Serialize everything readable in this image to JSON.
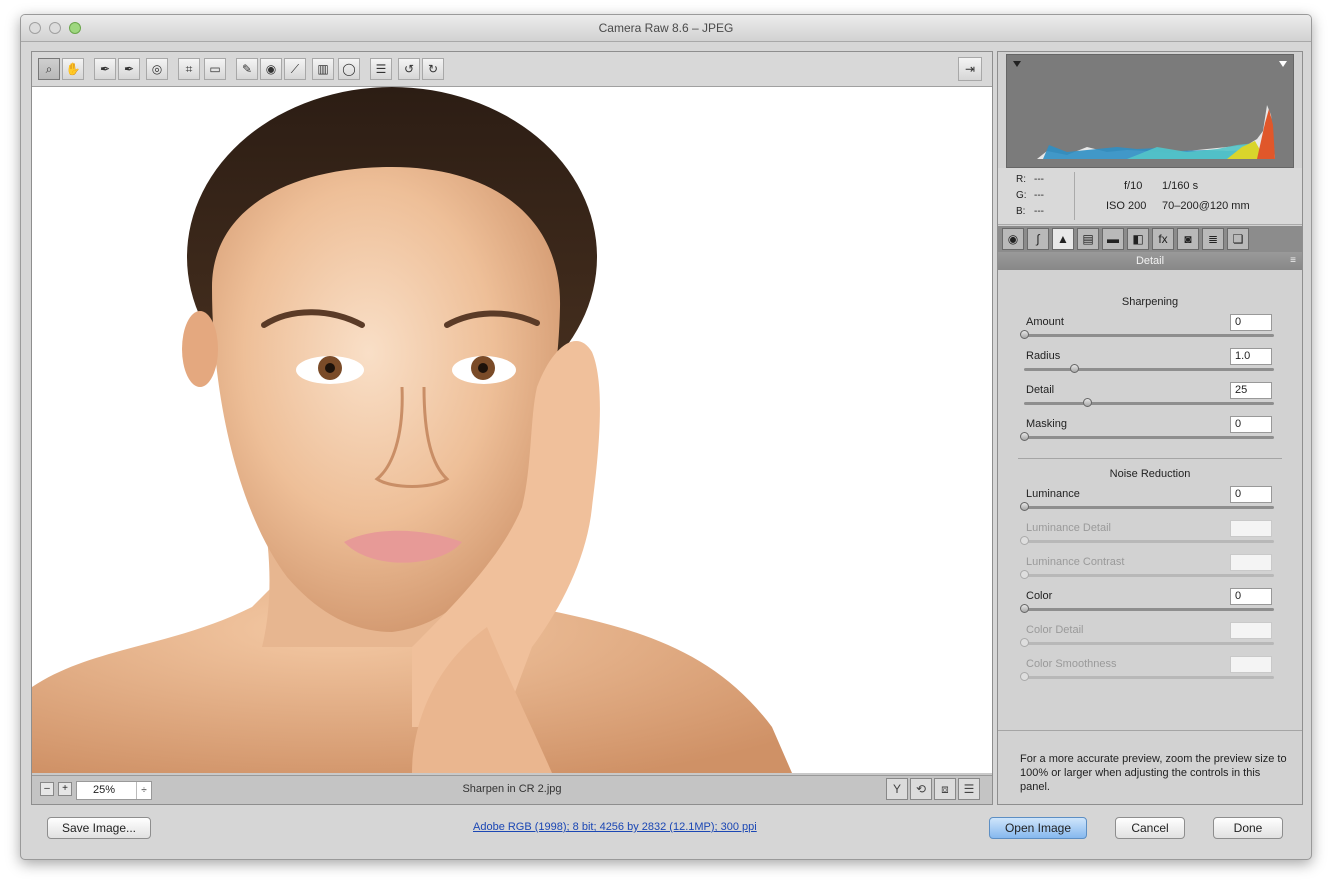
{
  "window": {
    "title": "Camera Raw 8.6  –  JPEG"
  },
  "toolbar": {
    "tools": [
      {
        "name": "zoom-tool",
        "glyph": "⌕"
      },
      {
        "name": "hand-tool",
        "glyph": "✋"
      },
      {
        "name": "white-balance-tool",
        "glyph": "✒"
      },
      {
        "name": "color-sampler-tool",
        "glyph": "✒"
      },
      {
        "name": "targeted-adjustment-tool",
        "glyph": "◎"
      },
      {
        "name": "crop-tool",
        "glyph": "⌗"
      },
      {
        "name": "straighten-tool",
        "glyph": "▭"
      },
      {
        "name": "spot-removal-tool",
        "glyph": "✎"
      },
      {
        "name": "red-eye-tool",
        "glyph": "◉"
      },
      {
        "name": "adjustment-brush-tool",
        "glyph": "⟋"
      },
      {
        "name": "graduated-filter-tool",
        "glyph": "▥"
      },
      {
        "name": "radial-filter-tool",
        "glyph": "◯"
      },
      {
        "name": "preferences-tool",
        "glyph": "☰"
      },
      {
        "name": "rotate-left-tool",
        "glyph": "↺"
      },
      {
        "name": "rotate-right-tool",
        "glyph": "↻"
      }
    ],
    "fullscreen_icon": "⇥"
  },
  "statusbar": {
    "zoom": "25%",
    "zoom_stepper": "÷",
    "zoom_out": "–",
    "zoom_in": "+",
    "filename": "Sharpen in CR 2.jpg",
    "view_buttons": [
      "Y",
      "⟲",
      "⧈",
      "☰"
    ]
  },
  "info": {
    "r_label": "R:",
    "g_label": "G:",
    "b_label": "B:",
    "r_value": "---",
    "g_value": "---",
    "b_value": "---",
    "aperture": "f/10",
    "shutter": "1/160 s",
    "iso": "ISO 200",
    "lens": "70–200@120 mm"
  },
  "panel_tabs": [
    {
      "name": "basic-tab",
      "glyph": "◉"
    },
    {
      "name": "tone-curve-tab",
      "glyph": "∫"
    },
    {
      "name": "detail-tab",
      "glyph": "▲"
    },
    {
      "name": "hsl-tab",
      "glyph": "▤"
    },
    {
      "name": "split-toning-tab",
      "glyph": "▬"
    },
    {
      "name": "lens-corrections-tab",
      "glyph": "◧"
    },
    {
      "name": "effects-tab",
      "glyph": "fx"
    },
    {
      "name": "camera-calibration-tab",
      "glyph": "◙"
    },
    {
      "name": "presets-tab",
      "glyph": "≣"
    },
    {
      "name": "snapshots-tab",
      "glyph": "❏"
    }
  ],
  "panel": {
    "header": "Detail",
    "menu_icon": "≡",
    "sharpening_title": "Sharpening",
    "noise_title": "Noise Reduction",
    "sharpening": [
      {
        "label": "Amount",
        "value": "0",
        "level": 0.0,
        "enabled": true
      },
      {
        "label": "Radius",
        "value": "1.0",
        "level": 0.2,
        "enabled": true
      },
      {
        "label": "Detail",
        "value": "25",
        "level": 0.25,
        "enabled": true
      },
      {
        "label": "Masking",
        "value": "0",
        "level": 0.0,
        "enabled": true
      }
    ],
    "noise": [
      {
        "label": "Luminance",
        "value": "0",
        "level": 0.0,
        "enabled": true
      },
      {
        "label": "Luminance Detail",
        "value": "",
        "level": 0.0,
        "enabled": false
      },
      {
        "label": "Luminance Contrast",
        "value": "",
        "level": 0.0,
        "enabled": false
      },
      {
        "label": "Color",
        "value": "0",
        "level": 0.0,
        "enabled": true
      },
      {
        "label": "Color Detail",
        "value": "",
        "level": 0.0,
        "enabled": false
      },
      {
        "label": "Color Smoothness",
        "value": "",
        "level": 0.0,
        "enabled": false
      }
    ],
    "help_text": "For a more accurate preview, zoom the preview size to 100% or larger when adjusting the controls in this panel."
  },
  "footer": {
    "save_label": "Save Image...",
    "workflow_link": "Adobe RGB (1998); 8 bit; 4256 by 2832 (12.1MP); 300 ppi",
    "open_label": "Open Image",
    "cancel_label": "Cancel",
    "done_label": "Done"
  },
  "colors": {
    "accent": "#86b8ee",
    "link": "#1b47b4",
    "histogram_bg": "#7b7b7b"
  }
}
